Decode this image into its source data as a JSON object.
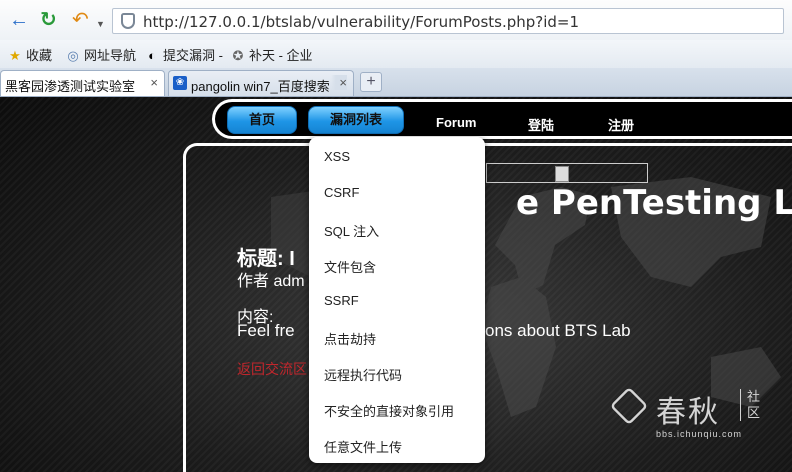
{
  "browser": {
    "url": "http://127.0.0.1/btslab/vulnerability/ForumPosts.php?id=1",
    "bookmarks": [
      {
        "label": "收藏",
        "icon": "star-icon"
      },
      {
        "label": "网址导航",
        "icon": "globe-icon"
      },
      {
        "label": "提交漏洞 -",
        "icon": "tencent-icon"
      },
      {
        "label": "补天 - 企业",
        "icon": "butian-icon"
      }
    ],
    "tabs": [
      {
        "label": "黑客园渗透测试实验室",
        "active": true
      },
      {
        "label": "pangolin win7_百度搜索",
        "active": false
      }
    ],
    "tab_close": "×",
    "new_tab": "+"
  },
  "nav": {
    "items": [
      {
        "label": "首页"
      },
      {
        "label": "漏洞列表"
      },
      {
        "label": "Forum"
      },
      {
        "label": "登陆"
      },
      {
        "label": "注册"
      }
    ]
  },
  "dropdown": {
    "items": [
      "XSS",
      "CSRF",
      "SQL 注入",
      "文件包含",
      "SSRF",
      "点击劫持",
      "远程执行代码",
      "不安全的直接对象引用",
      "任意文件上传"
    ]
  },
  "hero": {
    "title_visible": "e PenTesting Lab"
  },
  "post": {
    "title_visible": "标题: I",
    "author_visible": "作者 adm",
    "content_label": "内容:",
    "content_left_visible": "Feel fre",
    "content_right_visible": "ons about BTS Lab",
    "back_link_visible": "返回交流区"
  },
  "watermark": {
    "name": "春秋",
    "side": "社区",
    "url": "bbs.ichunqiu.com"
  },
  "colors": {
    "nav_pill": "#1e95e6",
    "back_link": "#c0262c",
    "page_bg": "#1c1c1c"
  }
}
